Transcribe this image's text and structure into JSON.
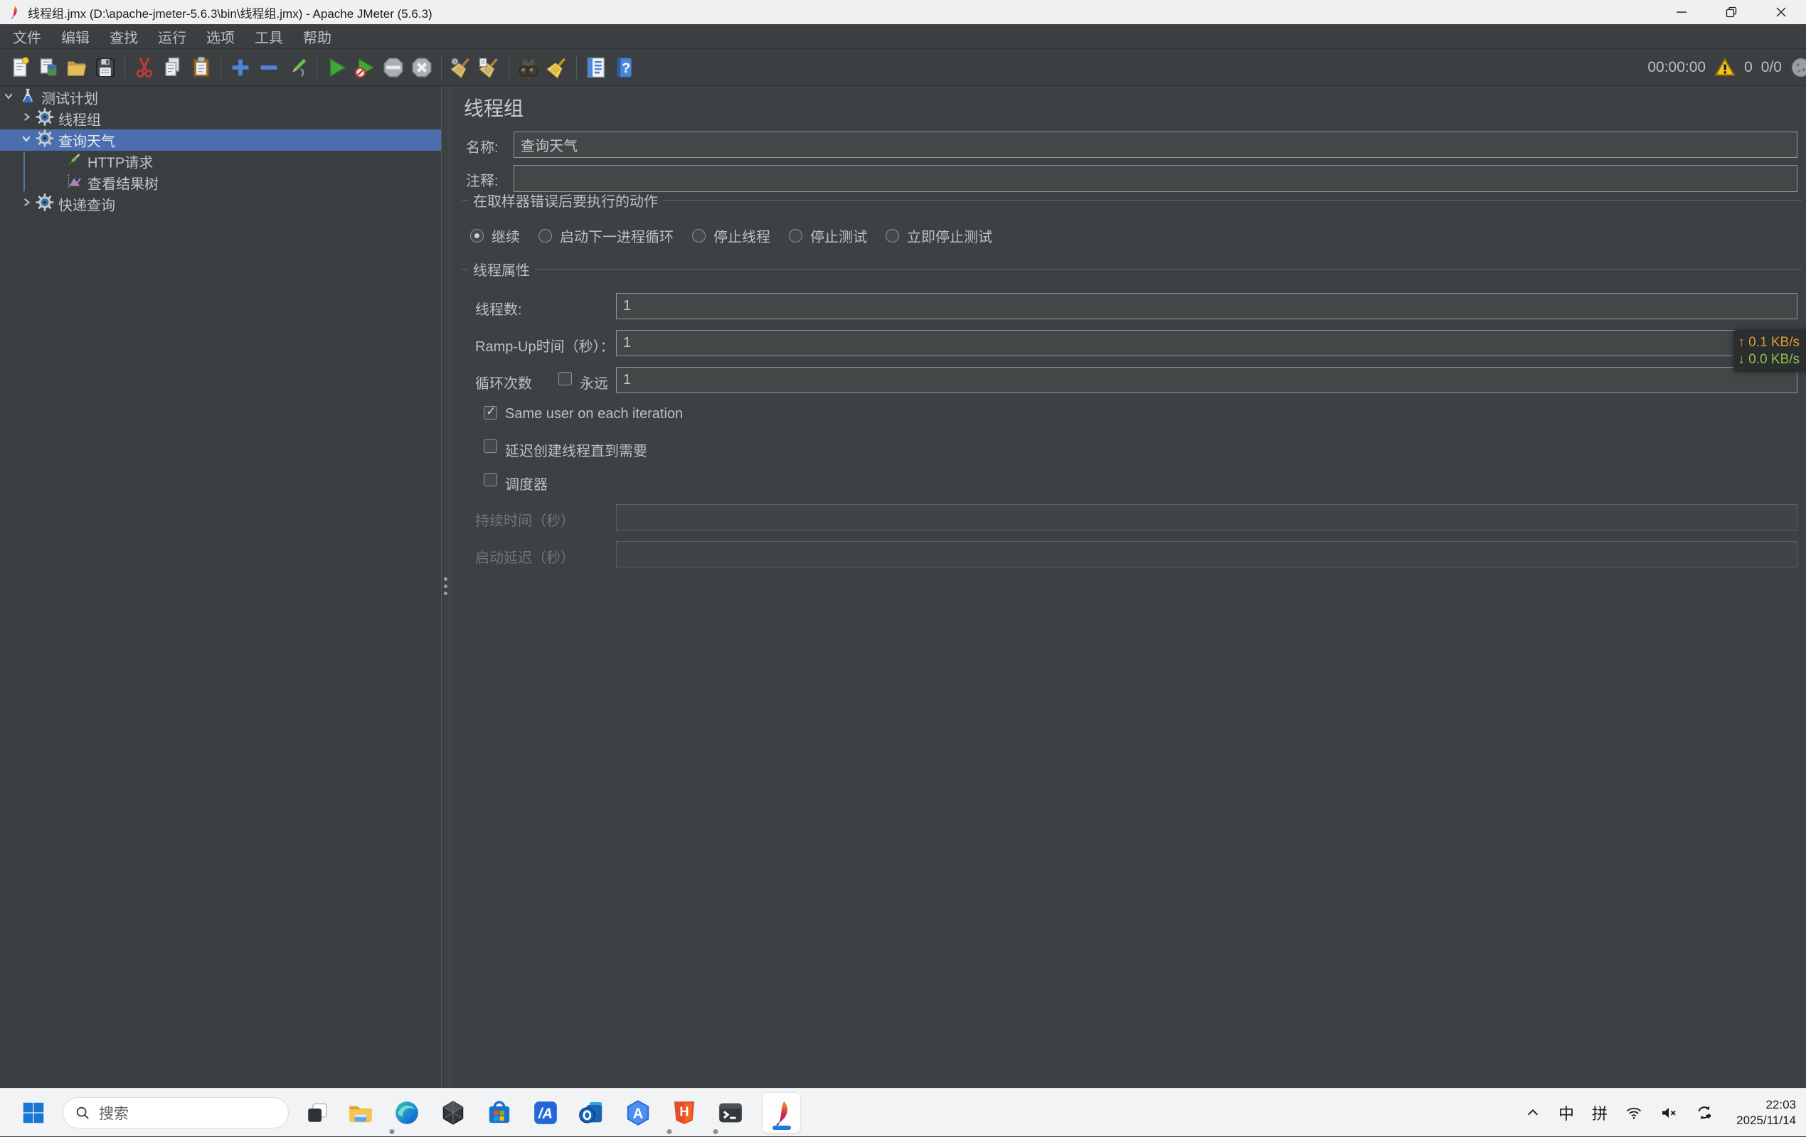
{
  "window": {
    "title": "线程组.jmx (D:\\apache-jmeter-5.6.3\\bin\\线程组.jmx) - Apache JMeter (5.6.3)",
    "controls": [
      "minimize",
      "maximize",
      "close"
    ]
  },
  "menubar": {
    "items": [
      {
        "label": "文件"
      },
      {
        "label": "编辑"
      },
      {
        "label": "查找"
      },
      {
        "label": "运行"
      },
      {
        "label": "选项"
      },
      {
        "label": "工具"
      },
      {
        "label": "帮助"
      }
    ]
  },
  "toolbar": {
    "icons": [
      "new-file",
      "templates",
      "open-file",
      "save",
      "cut",
      "copy",
      "paste",
      "expand-all",
      "collapse-all",
      "toggle",
      "start",
      "start-no-pauses",
      "stop",
      "shutdown",
      "clear",
      "clear-all",
      "search",
      "search-reset",
      "function-helper",
      "help"
    ],
    "status": {
      "elapsed": "00:00:00",
      "warning_count": "0",
      "threads": "0/0"
    }
  },
  "tree": {
    "items": [
      {
        "label": "测试计划",
        "level": 0,
        "icon": "test-plan-flask",
        "expanded": true,
        "selected": false
      },
      {
        "label": "线程组",
        "level": 1,
        "icon": "thread-group-gear",
        "expanded": false,
        "selected": false
      },
      {
        "label": "查询天气",
        "level": 1,
        "icon": "thread-group-gear",
        "expanded": true,
        "selected": true
      },
      {
        "label": "HTTP请求",
        "level": 2,
        "icon": "http-sampler",
        "expanded": null,
        "selected": false
      },
      {
        "label": "查看结果树",
        "level": 2,
        "icon": "results-tree",
        "expanded": null,
        "selected": false
      },
      {
        "label": "快递查询",
        "level": 1,
        "icon": "thread-group-gear",
        "expanded": false,
        "selected": false
      }
    ]
  },
  "main": {
    "header": "线程组",
    "name_label": "名称:",
    "name_value": "查询天气",
    "comment_label": "注释:",
    "comment_value": "",
    "error_action": {
      "title": "在取样器错误后要执行的动作",
      "options": [
        {
          "label": "继续",
          "selected": true
        },
        {
          "label": "启动下一进程循环",
          "selected": false
        },
        {
          "label": "停止线程",
          "selected": false
        },
        {
          "label": "停止测试",
          "selected": false
        },
        {
          "label": "立即停止测试",
          "selected": false
        }
      ]
    },
    "thread_props": {
      "title": "线程属性",
      "threads_label": "线程数:",
      "threads_value": "1",
      "rampup_label": "Ramp-Up时间（秒）：",
      "rampup_value": "1",
      "loop_label": "循环次数",
      "forever_label": "永远",
      "forever_checked": false,
      "loop_value": "1",
      "same_user_label": "Same user on each iteration",
      "same_user_checked": true,
      "delay_create_label": "延迟创建线程直到需要",
      "delay_create_checked": false,
      "scheduler_label": "调度器",
      "scheduler_checked": false,
      "duration_label": "持续时间（秒）",
      "duration_value": "",
      "startup_delay_label": "启动延迟（秒）",
      "startup_delay_value": ""
    }
  },
  "network_overlay": {
    "up": "↑ 0.1 KB/s",
    "down": "↓ 0.0 KB/s",
    "up_color": "#d89c36",
    "down_color": "#8cc24a"
  },
  "taskbar": {
    "search_placeholder": "搜索",
    "apps": [
      {
        "name": "file-explorer",
        "running": false
      },
      {
        "name": "edge-browser",
        "running": true
      },
      {
        "name": "dark-gem-app",
        "running": false
      },
      {
        "name": "microsoft-store",
        "running": false
      },
      {
        "name": "a-slash-app",
        "running": false
      },
      {
        "name": "outlook",
        "running": false
      },
      {
        "name": "hex-a-app",
        "running": false
      },
      {
        "name": "html5-app",
        "running": true
      },
      {
        "name": "terminal",
        "running": true
      },
      {
        "name": "jmeter",
        "running": true,
        "active": true
      }
    ],
    "tray": {
      "hidden_icons_glyph": "^",
      "ime_lang": "中",
      "ime_mode": "拼",
      "icons": [
        "wifi",
        "volume-muted",
        "sync-heart"
      ]
    },
    "clock": {
      "time": "22:03",
      "date": "2025/11/14"
    }
  }
}
